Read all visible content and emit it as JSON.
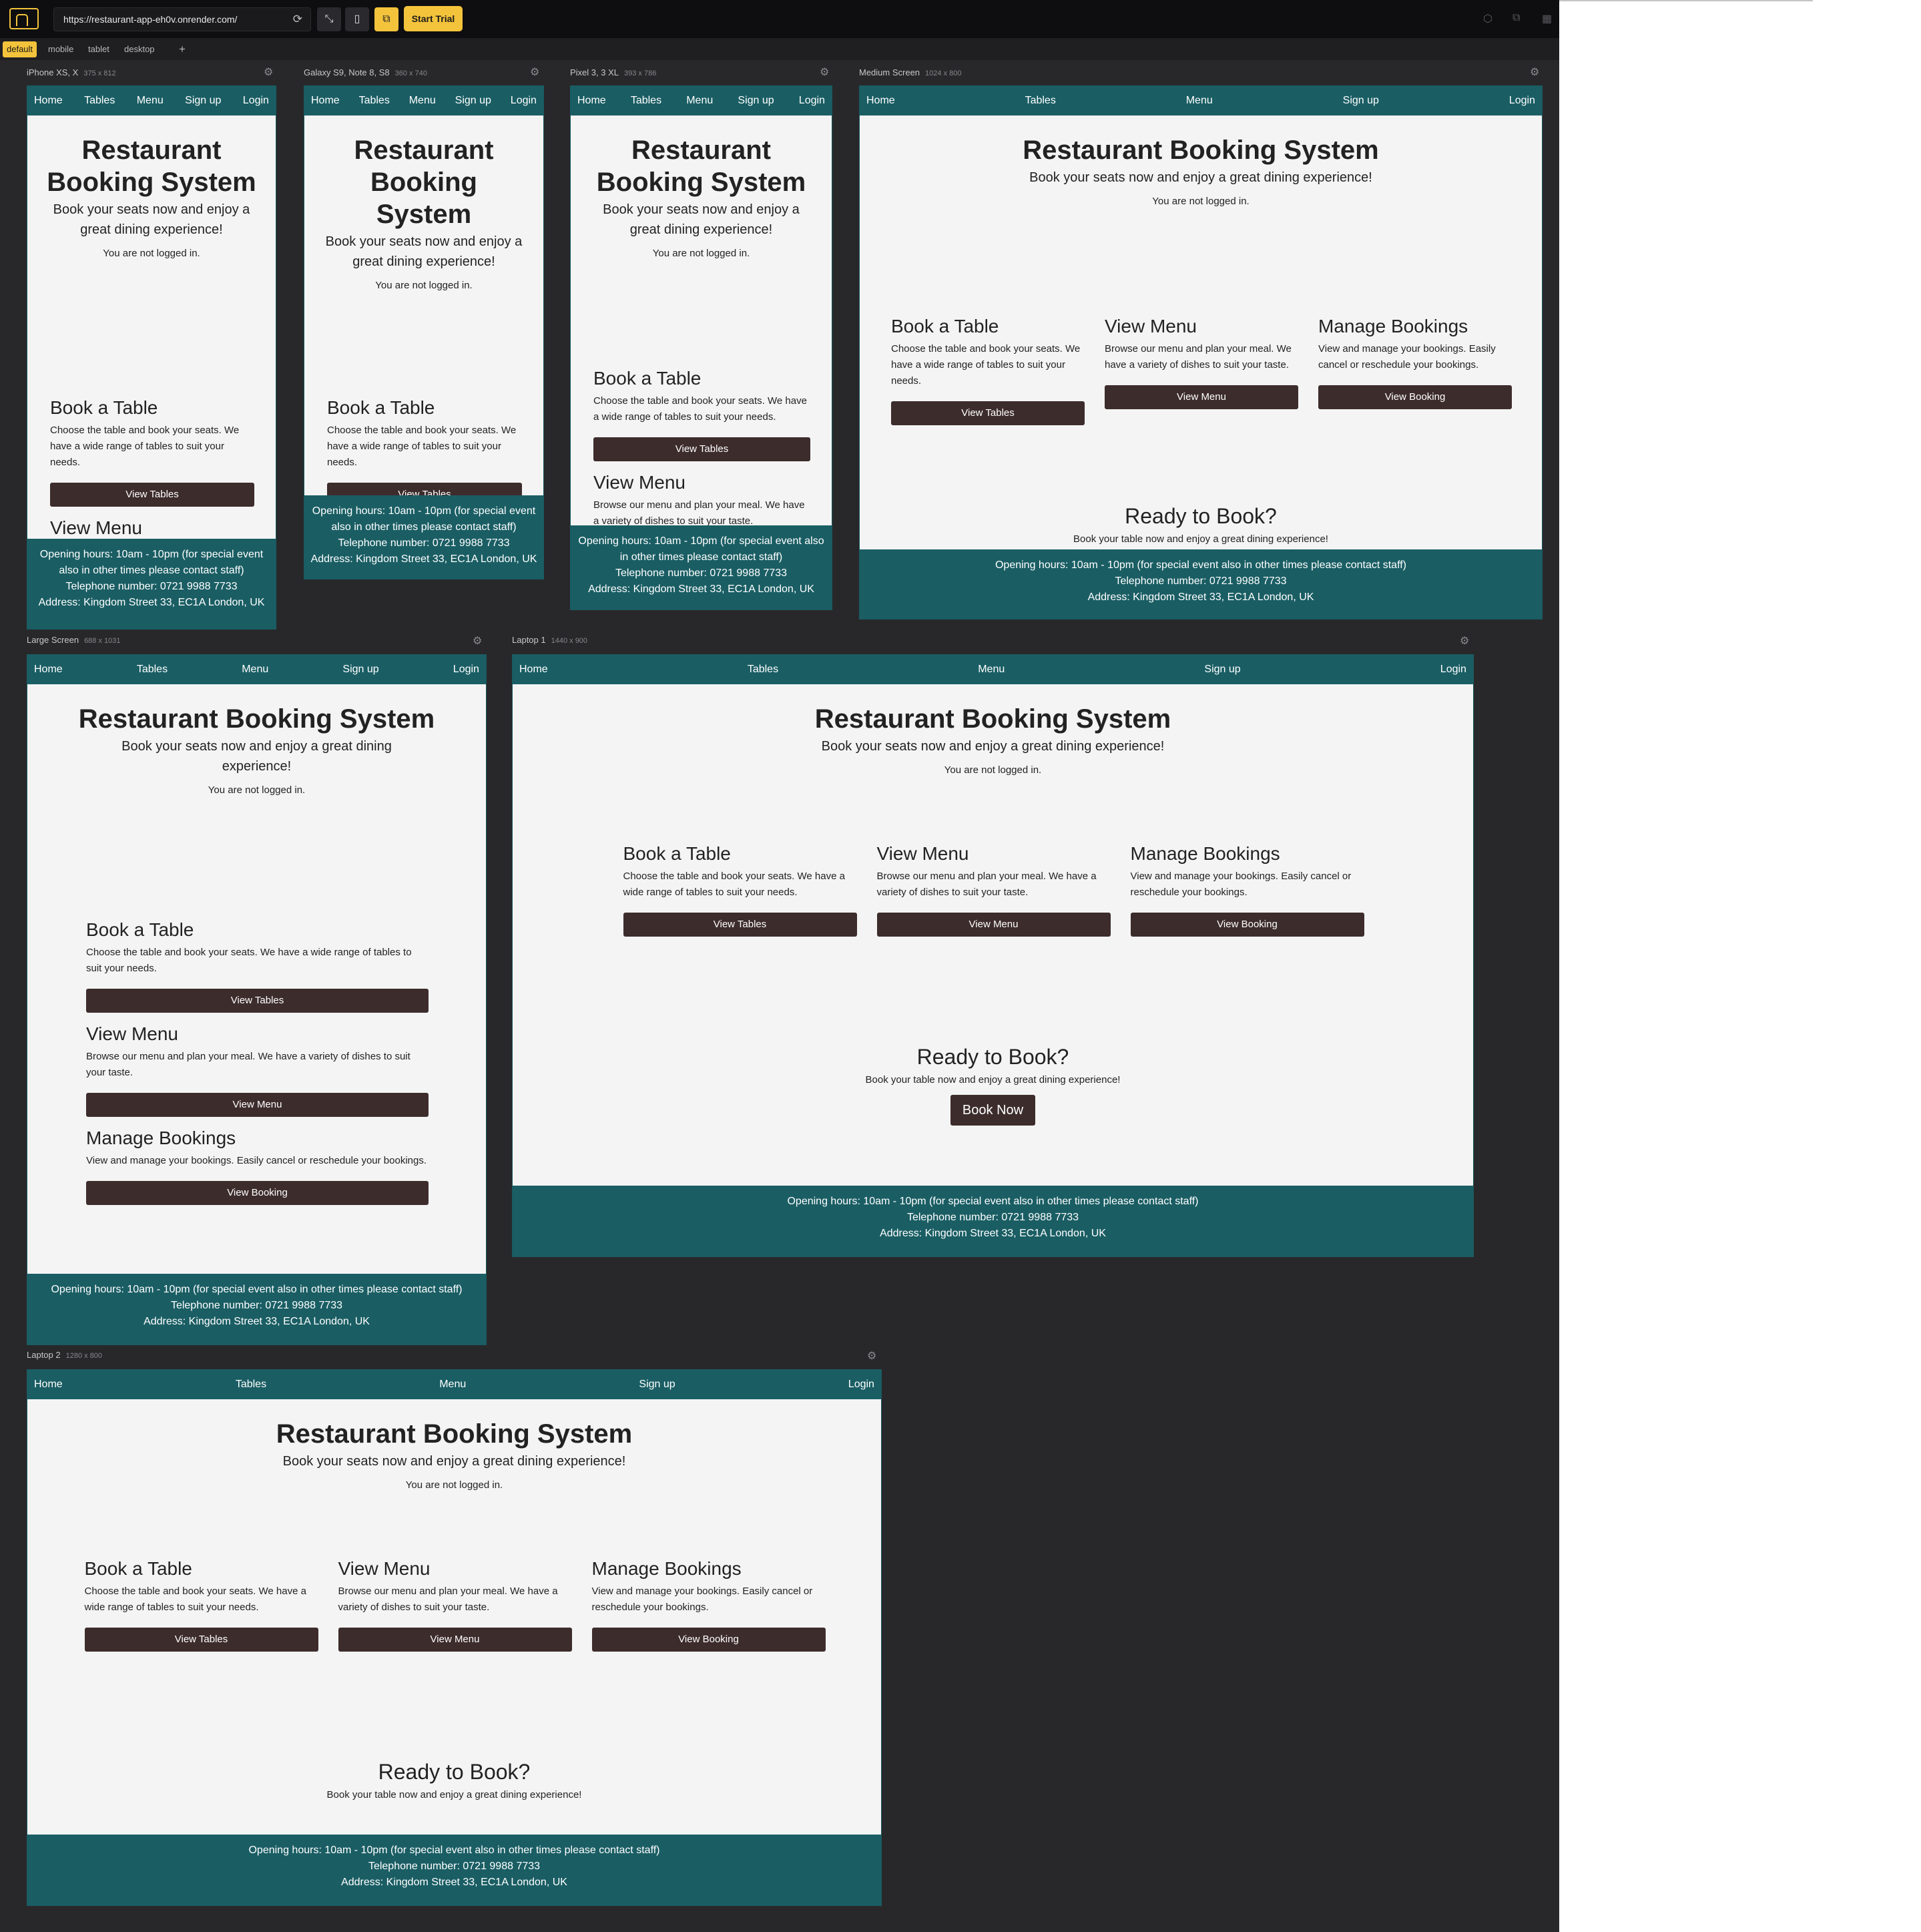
{
  "toolbar": {
    "url": "https://restaurant-app-eh0v.onrender.com/",
    "start_trial": "Start Trial",
    "icons": [
      "home-logo-icon",
      "reload-icon",
      "dimensions-icon",
      "mobile-icon",
      "responsive-icon",
      "cube-icon",
      "layers-icon",
      "grid-icon"
    ]
  },
  "tabs": [
    "default",
    "mobile",
    "tablet",
    "desktop",
    "+"
  ],
  "site": {
    "nav": [
      "Home",
      "Tables",
      "Menu",
      "Sign up",
      "Login"
    ],
    "title": "Restaurant Booking System",
    "subtitle": "Book your seats now and enjoy a great dining experience!",
    "status": "You are not logged in.",
    "cards": [
      {
        "title": "Book a Table",
        "text": "Choose the table and book your seats. We have a wide range of tables to suit your needs.",
        "button": "View Tables"
      },
      {
        "title": "View Menu",
        "text": "Browse our menu and plan your meal. We have a variety of dishes to suit your taste.",
        "button": "View Menu"
      },
      {
        "title": "Manage Bookings",
        "text": "View and manage your bookings. Easily cancel or reschedule your bookings.",
        "button": "View Booking"
      }
    ],
    "ready_title": "Ready to Book?",
    "ready_text": "Book your table now and enjoy a great dining experience!",
    "book_now": "Book Now",
    "footer": {
      "hours": "Opening hours: 10am - 10pm (for special event also in other times please contact staff)",
      "phone": "Telephone number: 0721 9988 7733",
      "address": "Address: Kingdom Street 33, EC1A London, UK"
    }
  },
  "devices": [
    {
      "name": "iPhone XS, X",
      "dims": "375 x 812"
    },
    {
      "name": "Galaxy S9, Note 8, S8",
      "dims": "360 x 740"
    },
    {
      "name": "Pixel 3, 3 XL",
      "dims": "393 x 786"
    },
    {
      "name": "Medium Screen",
      "dims": "1024 x 800"
    },
    {
      "name": "Large Screen",
      "dims": "688 x 1031"
    },
    {
      "name": "Laptop 1",
      "dims": "1440 x 900"
    },
    {
      "name": "Laptop 2",
      "dims": "1280 x 800"
    }
  ],
  "colors": {
    "nav": "#1a5e64",
    "button": "#3d2c2c",
    "accent": "#f3c33b",
    "page": "#f4f4f4",
    "frame": "#28282b"
  }
}
